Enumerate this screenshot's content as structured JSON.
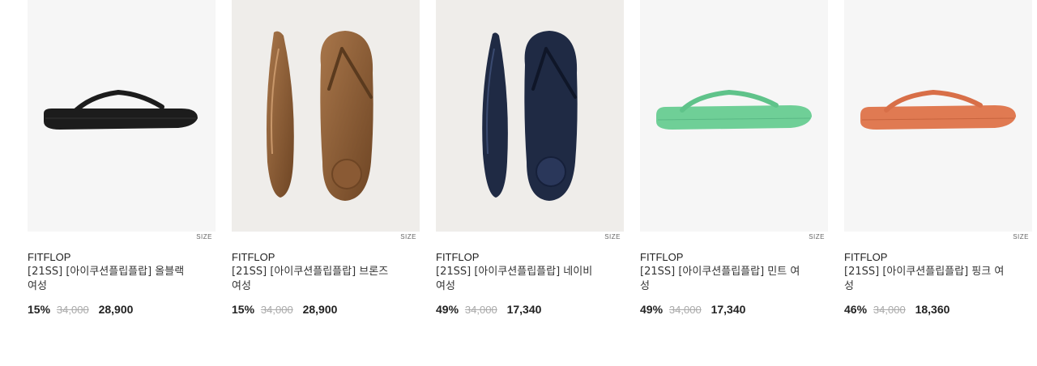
{
  "products": [
    {
      "brand": "FITFLOP",
      "title": "[21SS] [아이쿠션플립플랍] 올블랙 여성",
      "size_label": "SIZE",
      "discount": "15%",
      "original_price": "34,000",
      "sale_price": "28,900",
      "color": "#1c1c1c"
    },
    {
      "brand": "FITFLOP",
      "title": "[21SS] [아이쿠션플립플랍] 브론즈 여성",
      "size_label": "SIZE",
      "discount": "15%",
      "original_price": "34,000",
      "sale_price": "28,900",
      "color": "#8a5a34"
    },
    {
      "brand": "FITFLOP",
      "title": "[21SS] [아이쿠션플립플랍] 네이비 여성",
      "size_label": "SIZE",
      "discount": "49%",
      "original_price": "34,000",
      "sale_price": "17,340",
      "color": "#1f2a44"
    },
    {
      "brand": "FITFLOP",
      "title": "[21SS] [아이쿠션플립플랍] 민트 여성",
      "size_label": "SIZE",
      "discount": "49%",
      "original_price": "34,000",
      "sale_price": "17,340",
      "color": "#6fcf97"
    },
    {
      "brand": "FITFLOP",
      "title": "[21SS] [아이쿠션플립플랍] 핑크 여성",
      "size_label": "SIZE",
      "discount": "46%",
      "original_price": "34,000",
      "sale_price": "18,360",
      "color": "#e07a52"
    }
  ]
}
